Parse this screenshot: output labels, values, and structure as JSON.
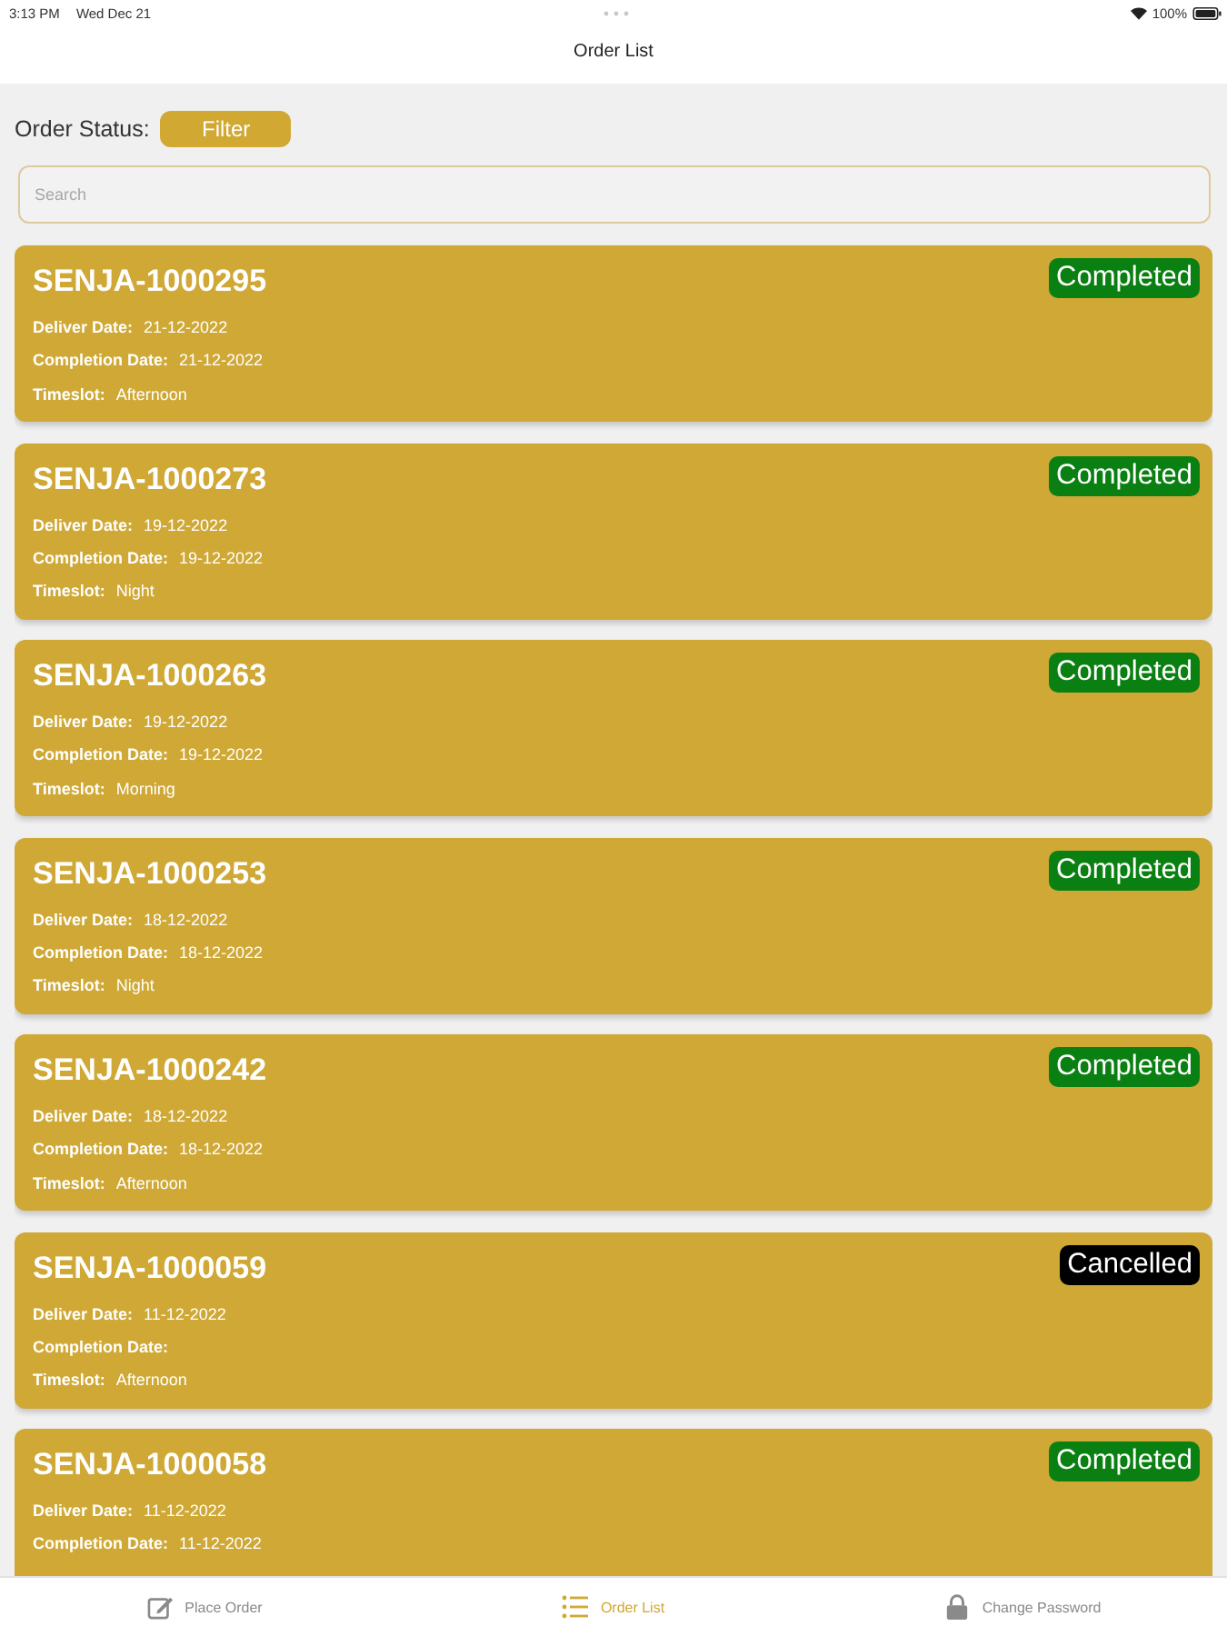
{
  "status_bar": {
    "time": "3:13 PM",
    "date": "Wed Dec 21",
    "battery": "100%"
  },
  "nav": {
    "title": "Order List"
  },
  "filter": {
    "label": "Order Status:",
    "button": "Filter"
  },
  "search": {
    "placeholder": "Search"
  },
  "orders": [
    {
      "number": "SENJA-1000295",
      "status": "Completed",
      "color": "#0b8012",
      "fields": [
        {
          "label": "Deliver Date:",
          "value": "21-12-2022"
        },
        {
          "label": "Completion Date:",
          "value": "21-12-2022"
        },
        {
          "label": "Timeslot:",
          "value": "Afternoon"
        }
      ]
    },
    {
      "number": "SENJA-1000273",
      "status": "Completed",
      "color": "#0b8012",
      "fields": [
        {
          "label": "Deliver Date:",
          "value": "19-12-2022"
        },
        {
          "label": "Completion Date:",
          "value": "19-12-2022"
        },
        {
          "label": "Timeslot:",
          "value": "Night"
        }
      ]
    },
    {
      "number": "SENJA-1000263",
      "status": "Completed",
      "color": "#0b8012",
      "fields": [
        {
          "label": "Deliver Date:",
          "value": "19-12-2022"
        },
        {
          "label": "Completion Date:",
          "value": "19-12-2022"
        },
        {
          "label": "Timeslot:",
          "value": "Morning"
        }
      ]
    },
    {
      "number": "SENJA-1000253",
      "status": "Completed",
      "color": "#0b8012",
      "fields": [
        {
          "label": "Deliver Date:",
          "value": "18-12-2022"
        },
        {
          "label": "Completion Date:",
          "value": "18-12-2022"
        },
        {
          "label": "Timeslot:",
          "value": "Night"
        }
      ]
    },
    {
      "number": "SENJA-1000242",
      "status": "Completed",
      "color": "#0b8012",
      "fields": [
        {
          "label": "Deliver Date:",
          "value": "18-12-2022"
        },
        {
          "label": "Completion Date:",
          "value": "18-12-2022"
        },
        {
          "label": "Timeslot:",
          "value": "Afternoon"
        }
      ]
    },
    {
      "number": "SENJA-1000059",
      "status": "Cancelled",
      "color": "#000000",
      "fields": [
        {
          "label": "Deliver Date:",
          "value": "11-12-2022"
        },
        {
          "label": "Completion Date:"
        },
        {
          "label": "Timeslot:",
          "value": "Afternoon"
        }
      ]
    },
    {
      "number": "SENJA-1000058",
      "status": "Completed",
      "color": "#0b8012",
      "fields": [
        {
          "label": "Deliver Date:",
          "value": "11-12-2022"
        },
        {
          "label": "Completion Date:",
          "value": "11-12-2022"
        }
      ]
    }
  ],
  "tab_bar": [
    {
      "label": "Place Order",
      "kind": "compose",
      "selected": false
    },
    {
      "label": "Order List",
      "kind": "list",
      "selected": true
    },
    {
      "label": "Change Password",
      "kind": "lock",
      "selected": false
    }
  ]
}
